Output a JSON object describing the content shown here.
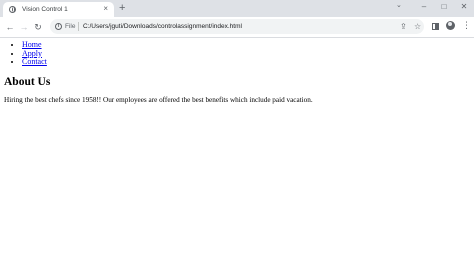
{
  "browser": {
    "tab": {
      "title": "Vision Control 1",
      "close_glyph": "×",
      "favicon": "globe-icon"
    },
    "new_tab_glyph": "+",
    "window_controls": [
      "⌄",
      "–",
      "□",
      "✕"
    ],
    "toolbar": {
      "back_glyph": "←",
      "forward_glyph": "→",
      "reload_glyph": "↻",
      "info_glyph": "i",
      "scheme_label": "File",
      "url": "C:/Users/jguti/Downloads/controlassignment/index.html",
      "share_glyph": "⇪",
      "bookmark_glyph": "☆",
      "menu_glyph": "⋮"
    }
  },
  "page": {
    "nav": [
      {
        "label": "Home"
      },
      {
        "label": "Apply"
      },
      {
        "label": "Contact"
      }
    ],
    "heading": "About Us",
    "paragraph": "Hiring the best chefs since 1958!! Our employees are offered the best benefits which include paid vacation."
  },
  "colors": {
    "tabstrip_bg": "#dee1e6",
    "omnibox_bg": "#f1f3f4",
    "link": "#0000ee"
  }
}
